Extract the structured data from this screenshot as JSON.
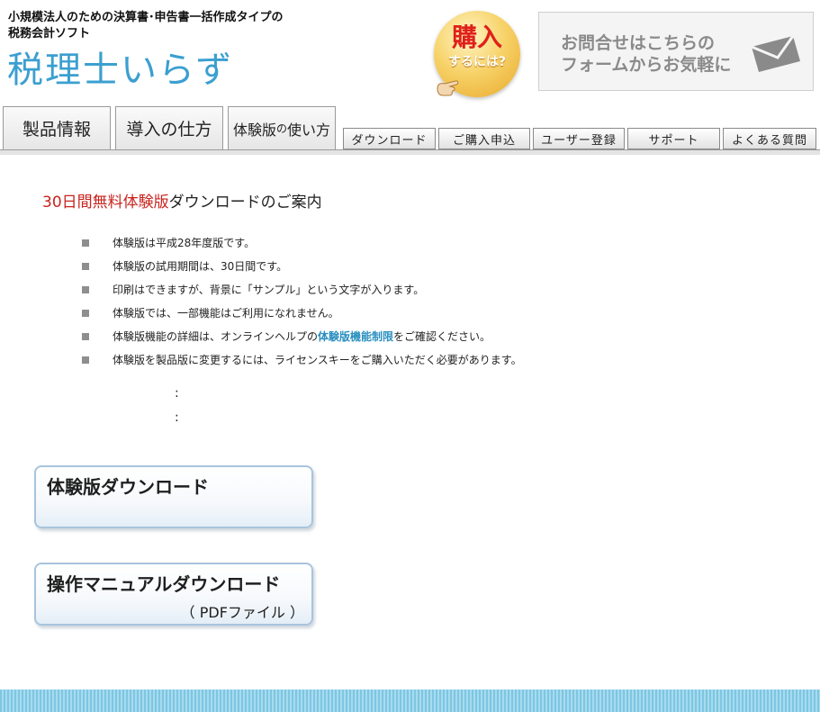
{
  "header": {
    "tagline_line1": "小規模法人のための決算書･申告書一括作成タイプの",
    "tagline_line2": "税務会計ソフト",
    "logo": "税理士いらず",
    "buy_badge": {
      "main": "購入",
      "sub": "するには?",
      "color": "#e0201a"
    },
    "contact": {
      "line1": "お問合せはこちらの",
      "line2": "フォームからお気軽に",
      "icon": "mail-icon"
    }
  },
  "nav": {
    "main_tabs": [
      {
        "label": "製品情報"
      },
      {
        "label": "導入の仕方"
      },
      {
        "label_a": "体験版",
        "label_b": "の",
        "label_c": "使い方"
      }
    ],
    "sub_tabs": [
      {
        "label": "ダウンロード"
      },
      {
        "label": "ご購入申込"
      },
      {
        "label": "ユーザー登録"
      },
      {
        "label": "サポート"
      },
      {
        "label": "よくある質問"
      }
    ]
  },
  "content": {
    "heading_red": "30日間無料体験版",
    "heading_rest": "ダウンロードのご案内",
    "notes": [
      {
        "text": "体験版は平成28年度版です。"
      },
      {
        "text": "体験版の試用期間は、30日間です。"
      },
      {
        "text": "印刷はできますが、背景に「サンプル」という文字が入ります。"
      },
      {
        "text": "体験版では、一部機能はご利用になれません。"
      },
      {
        "before": "体験版機能の詳細は、オンラインヘルプの",
        "link": "体験版機能制限",
        "after": "をご確認ください。"
      },
      {
        "text": "体験版を製品版に変更するには、ライセンスキーをご購入いただく必要があります。"
      }
    ],
    "dots": ":",
    "trial_download": {
      "label": "体験版ダウンロード"
    },
    "manual_download": {
      "label": "操作マニュアルダウンロード",
      "sub": "（ PDFファイル ）"
    }
  },
  "colors": {
    "logo": "#3b9fd0",
    "heading_red": "#c8231e",
    "link": "#2a8fc0",
    "footer": "#7ec6e2"
  }
}
